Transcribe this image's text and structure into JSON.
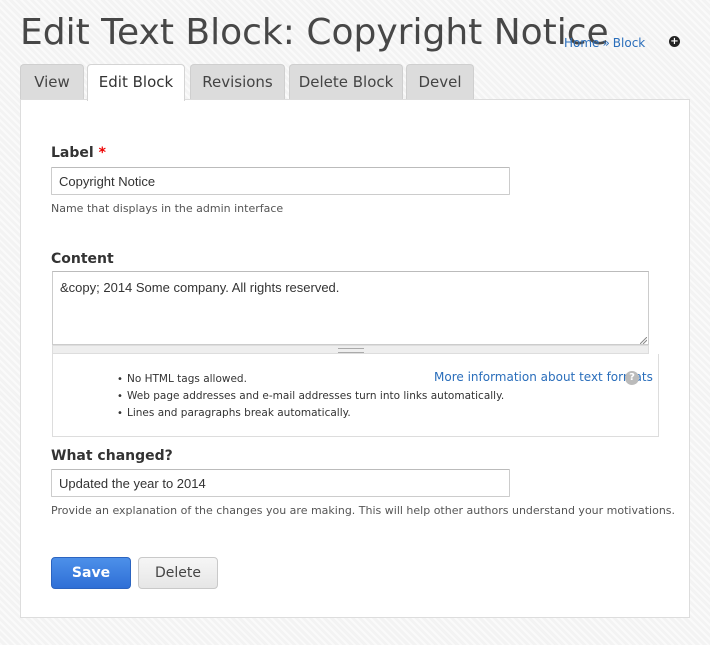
{
  "header": {
    "title": "Edit Text Block: Copyright Notice",
    "breadcrumb": [
      "Home",
      "Block"
    ],
    "breadcrumb_sep": "»",
    "shortcut_icon": "add-shortcut-icon"
  },
  "tabs": [
    {
      "label": "View",
      "active": false
    },
    {
      "label": "Edit Block",
      "active": true
    },
    {
      "label": "Revisions",
      "active": false
    },
    {
      "label": "Delete Block",
      "active": false
    },
    {
      "label": "Devel",
      "active": false
    }
  ],
  "form": {
    "label_field": {
      "label": "Label",
      "required_marker": "*",
      "value": "Copyright Notice",
      "description": "Name that displays in the admin interface"
    },
    "content_field": {
      "label": "Content",
      "value": "&copy; 2014 Some company. All rights reserved.",
      "format_tips": [
        "No HTML tags allowed.",
        "Web page addresses and e-mail addresses turn into links automatically.",
        "Lines and paragraphs break automatically."
      ],
      "more_info_link": "More information about text formats",
      "help_icon": "question-icon"
    },
    "revision_field": {
      "label": "What changed?",
      "value": "Updated the year to 2014",
      "description": "Provide an explanation of the changes you are making. This will help other authors understand your motivations."
    },
    "actions": {
      "save_label": "Save",
      "delete_label": "Delete"
    }
  },
  "colors": {
    "link": "#2a6ebb",
    "primary_button": "#3a7de0",
    "required": "#e00000"
  }
}
